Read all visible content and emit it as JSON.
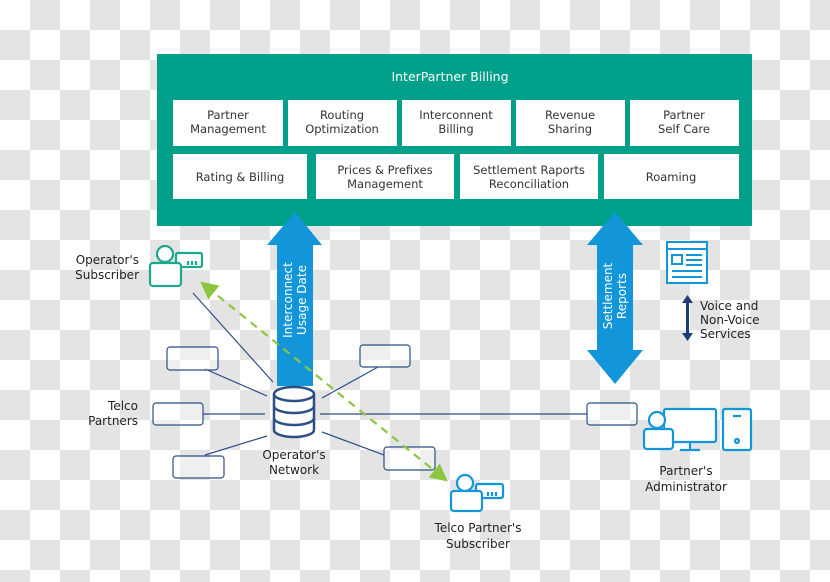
{
  "billing": {
    "title": "InterPartner Billing",
    "row1": [
      {
        "l1": "Partner",
        "l2": "Management"
      },
      {
        "l1": "Routing",
        "l2": "Optimization"
      },
      {
        "l1": "Interconnent",
        "l2": "Billing"
      },
      {
        "l1": "Revenue",
        "l2": "Sharing"
      },
      {
        "l1": "Partner",
        "l2": "Self Care"
      }
    ],
    "row2": [
      {
        "l1": "Rating & Billing"
      },
      {
        "l1": "Prices & Prefixes",
        "l2": "Management"
      },
      {
        "l1": "Settlement Raports",
        "l2": "Reconciliation"
      },
      {
        "l1": "Roaming"
      }
    ]
  },
  "arrows": {
    "usage": {
      "l1": "Interconnect",
      "l2": "Usage Date"
    },
    "settlement": {
      "l1": "Settlement",
      "l2": "Reports"
    },
    "services": {
      "l1": "Voice and",
      "l2": "Non-Voice",
      "l3": "Services"
    }
  },
  "nodes": {
    "operator_subscriber": {
      "l1": "Operator's",
      "l2": "Subscriber"
    },
    "telco_partners": {
      "l1": "Telco",
      "l2": "Partners"
    },
    "operator_network": {
      "l1": "Operator's",
      "l2": "Network"
    },
    "telco_partner_subscriber": {
      "l1": "Telco Partner's",
      "l2": "Subscriber"
    },
    "partner_administrator": {
      "l1": "Partner's",
      "l2": "Administrator"
    }
  },
  "colors": {
    "teal": "#00a08a",
    "blue": "#1296d9",
    "navy": "#2c4f86",
    "green": "#8cc63f"
  },
  "icons": [
    "database-icon",
    "user-router-icon",
    "web-page-icon",
    "computer-user-icon"
  ]
}
